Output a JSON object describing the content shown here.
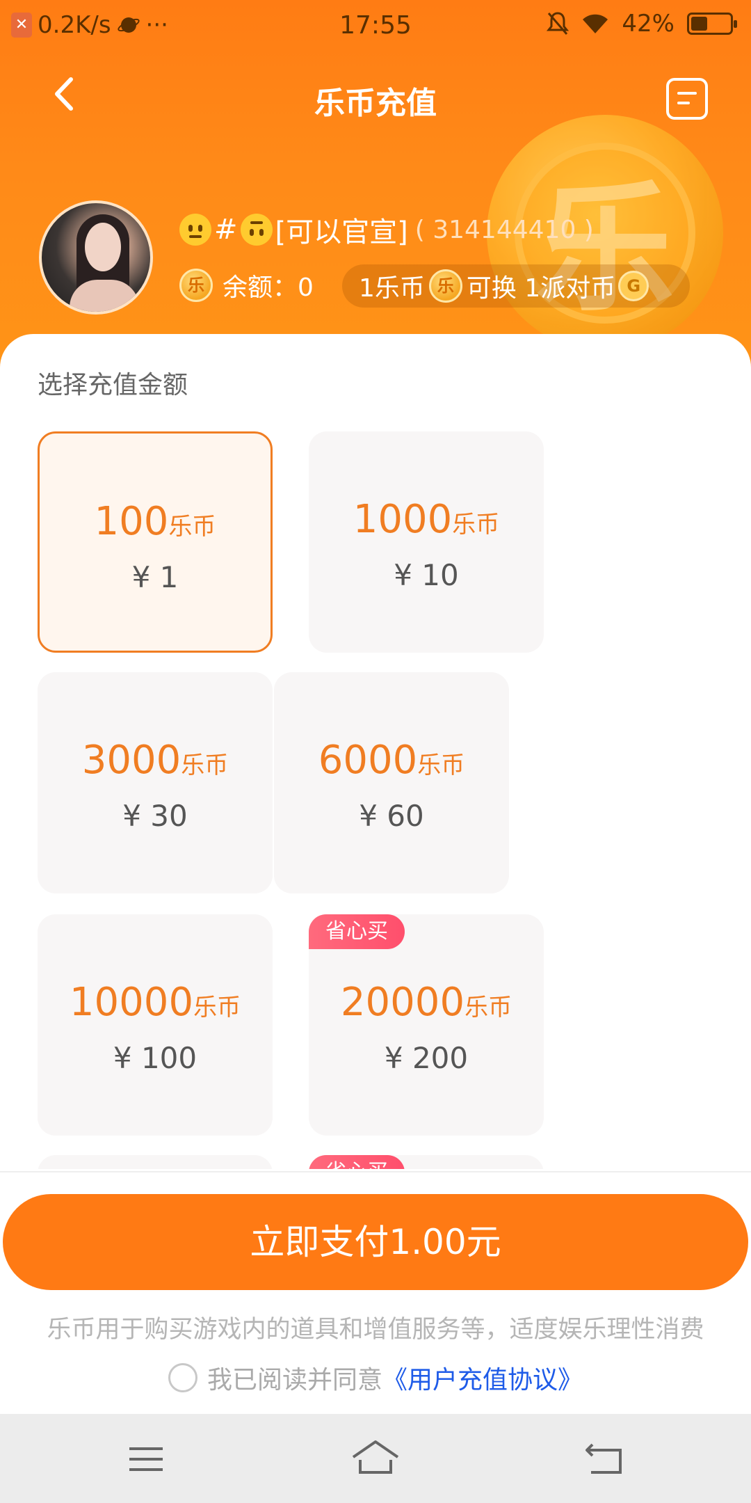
{
  "status_bar": {
    "net_speed": "0.2K/s",
    "more": "···",
    "time": "17:55",
    "battery_text": "42%",
    "battery_level": 0.42
  },
  "header": {
    "title": "乐币充值",
    "coin_glyph": "乐"
  },
  "user": {
    "name": "#",
    "name_suffix": "[可以官宣]",
    "id": "( 314144410 )",
    "balance": "余额：0",
    "coin_mark": "乐",
    "exchange_left": "1乐币",
    "exchange_right": "可换 1派对币",
    "party_coin_mark": "G"
  },
  "section_title": "选择充值金额",
  "packages": [
    {
      "coins": "100",
      "unit": "乐币",
      "price": "¥ 1",
      "tag": "",
      "selected": true
    },
    {
      "coins": "1000",
      "unit": "乐币",
      "price": "¥ 10",
      "tag": "",
      "selected": false
    },
    {
      "coins": "3000",
      "unit": "乐币",
      "price": "¥ 30",
      "tag": "",
      "selected": false
    },
    {
      "coins": "6000",
      "unit": "乐币",
      "price": "¥ 60",
      "tag": "",
      "selected": false
    },
    {
      "coins": "10000",
      "unit": "乐币",
      "price": "¥ 100",
      "tag": "",
      "selected": false
    },
    {
      "coins": "20000",
      "unit": "乐币",
      "price": "¥ 200",
      "tag": "省心买",
      "selected": false
    },
    {
      "coins": "",
      "unit": "",
      "price": "",
      "tag": "",
      "selected": false
    },
    {
      "coins": "",
      "unit": "",
      "price": "",
      "tag": "省心买",
      "selected": false
    }
  ],
  "pay_button": "立即支付1.00元",
  "footnote": "乐币用于购买游戏内的道具和增值服务等，适度娱乐理性消费",
  "agreement": {
    "prefix": "我已阅读并同意",
    "link": "《用户充值协议》",
    "checked": false
  },
  "colors": {
    "accent": "#ff7a14",
    "link": "#1e5be8",
    "tag": "#ff5a72"
  },
  "nav": {
    "icons": [
      "menu-icon",
      "home-icon",
      "back-icon"
    ]
  }
}
